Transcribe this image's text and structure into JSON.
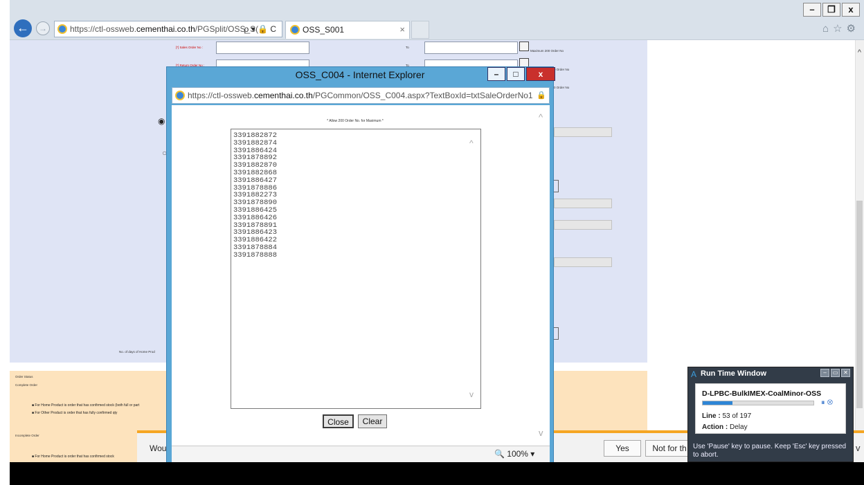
{
  "browser": {
    "url_prefix": "https://ctl-ossweb.",
    "url_domain": "cementhai.co.th",
    "url_path": "/PGSplit/OSS_S(",
    "addr_tools": "ρ ▾ 🔒 C",
    "tab_title": "OSS_S001",
    "tab_close": "×",
    "win_min": "–",
    "win_max": "❐",
    "win_close": "x",
    "back": "←",
    "forward": "→",
    "tool_icons": "⌂☆⚙"
  },
  "bg_form": {
    "sales_order_label": "[*] Sales Order No :",
    "return_order_label": "[*] Return Order No :",
    "to_label": "To",
    "max_note": "Maximum 200 Order No",
    "max_note_short": "0 Order No",
    "radio_selected": "◉",
    "radio_unselected": "○",
    "days_label": "No. of days of Home Prod",
    "scroll_up": "^"
  },
  "status_panel": {
    "heading": "Order Status",
    "complete": "Complete Order",
    "bullet1": "For Home Product is order that has confirmed stock (both full or part",
    "bullet2": "For Other Product is order that has fully confirmed qty",
    "incomplete": "Incomplete Order",
    "bullet3": "For Home Product is order that has confirmed stock"
  },
  "notification": {
    "text": "Woul",
    "yes": "Yes",
    "not_for": "Not for th"
  },
  "popup": {
    "title": "OSS_C004 - Internet Explorer",
    "url_prefix": "https://ctl-ossweb.",
    "url_domain": "cementhai.co.th",
    "url_path": "/PGCommon/OSS_C004.aspx?TextBoxId=txtSaleOrderNo1",
    "lock": "🔒",
    "note": "* Allow 200 Order No. for Maximum *",
    "orders": [
      "3391882872",
      "3391882874",
      "3391886424",
      "3391878892",
      "3391882870",
      "3391882868",
      "3391886427",
      "3391878886",
      "3391882273",
      "3391878890",
      "3391886425",
      "3391886426",
      "3391878891",
      "3391886423",
      "3391886422",
      "3391878884",
      "3391878888"
    ],
    "close_label": "Close",
    "clear_label": "Clear",
    "zoom": "🔍 100%  ▾",
    "btn_min": "–",
    "btn_max": "□",
    "btn_close": "x",
    "arrow_up": "^",
    "arrow_down": "v"
  },
  "runtime_window": {
    "title": "Run Time Window",
    "logo": "A",
    "job_name": "D-LPBC-BulkIMEX-CoalMinor-OSS",
    "line_label": "Line :",
    "line_value": "53 of 197",
    "progress": 0.27,
    "action_label": "Action :",
    "action_value": "Delay",
    "hint": "Use 'Pause' key to pause. Keep 'Esc' key pressed to abort.",
    "pause_icon": "⏸",
    "stop_icon": "⊗",
    "ctrl_a": "–",
    "ctrl_b": "▭",
    "ctrl_c": "✕"
  }
}
